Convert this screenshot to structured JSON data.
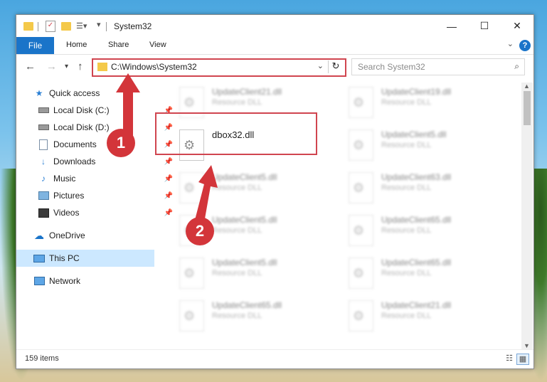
{
  "window": {
    "title": "System32",
    "controls": {
      "minimize": "—",
      "maximize": "☐",
      "close": "✕"
    }
  },
  "ribbon": {
    "tabs": [
      "File",
      "Home",
      "Share",
      "View"
    ],
    "help_label": "?"
  },
  "address": {
    "path": "C:\\Windows\\System32",
    "refresh_icon": "↻"
  },
  "search": {
    "placeholder": "Search System32"
  },
  "sidebar": {
    "items": [
      {
        "label": "Quick access",
        "icon": "star-icon"
      },
      {
        "label": "Local Disk (C:)",
        "icon": "drive-icon",
        "pinned": true
      },
      {
        "label": "Local Disk (D:)",
        "icon": "drive-icon",
        "pinned": true
      },
      {
        "label": "Documents",
        "icon": "documents-icon",
        "pinned": true
      },
      {
        "label": "Downloads",
        "icon": "download-icon",
        "pinned": true
      },
      {
        "label": "Music",
        "icon": "music-icon",
        "pinned": true
      },
      {
        "label": "Pictures",
        "icon": "pictures-icon",
        "pinned": true
      },
      {
        "label": "Videos",
        "icon": "videos-icon",
        "pinned": true
      },
      {
        "label": "OneDrive",
        "icon": "cloud-icon"
      },
      {
        "label": "This PC",
        "icon": "computer-icon",
        "selected": true
      },
      {
        "label": "Network",
        "icon": "network-icon"
      }
    ]
  },
  "files": {
    "highlighted": {
      "name": "dbox32.dll"
    },
    "blurred": [
      {
        "name": "UpdateClient21.dll",
        "type": "Resource DLL"
      },
      {
        "name": "UpdateClient19.dll",
        "type": "Resource DLL"
      },
      {
        "name": "UpdateClient5.dll",
        "type": "Resource DLL"
      },
      {
        "name": "UpdateClient5.dll",
        "type": "Resource DLL"
      },
      {
        "name": "UpdateClient63.dll",
        "type": "Resource DLL"
      },
      {
        "name": "UpdateClient5.dll",
        "type": "Resource DLL"
      },
      {
        "name": "UpdateClient65.dll",
        "type": "Resource DLL"
      },
      {
        "name": "UpdateClient5.dll",
        "type": "Resource DLL"
      },
      {
        "name": "UpdateClient65.dll",
        "type": "Resource DLL"
      },
      {
        "name": "UpdateClient65.dll",
        "type": "Resource DLL"
      },
      {
        "name": "UpdateClient21.dll",
        "type": "Resource DLL"
      }
    ]
  },
  "status": {
    "items": "159 items"
  },
  "annotations": {
    "badge1": "1",
    "badge2": "2",
    "color": "#d3353a"
  }
}
